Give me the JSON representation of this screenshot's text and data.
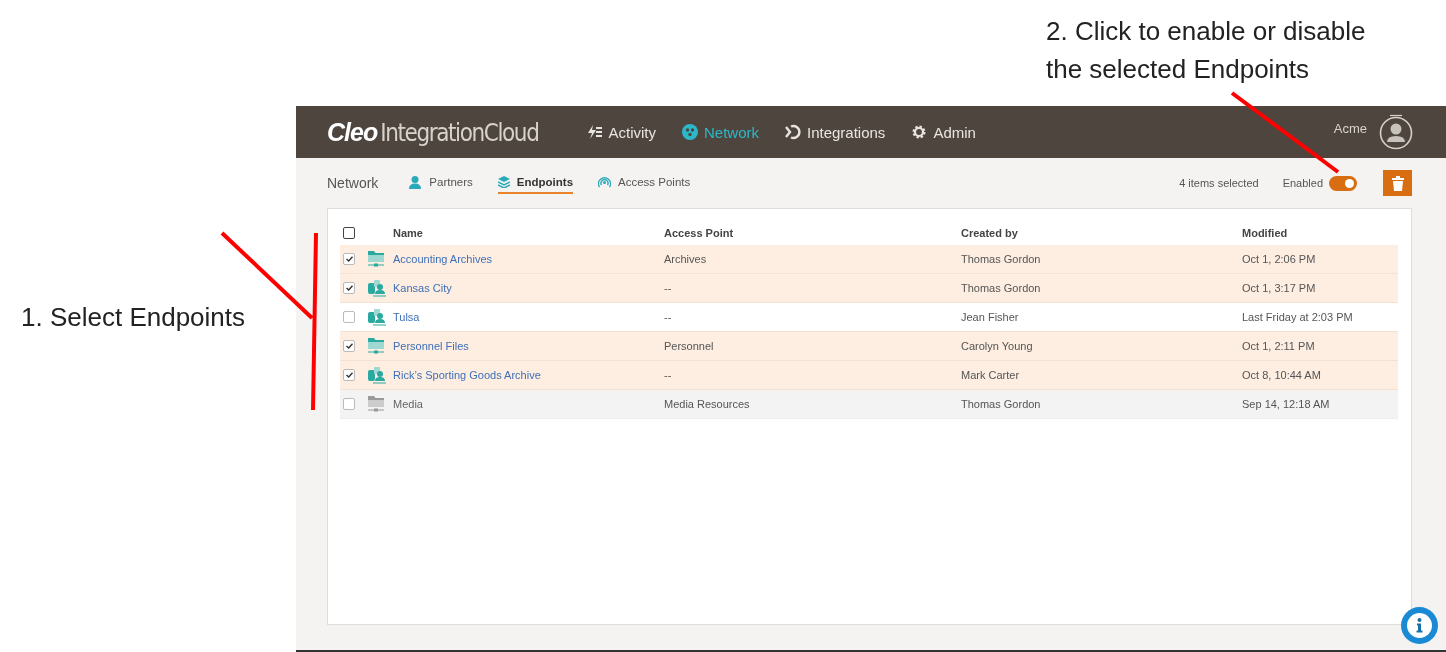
{
  "annotations": [
    {
      "text": "1. Select Endpoints"
    },
    {
      "text": "2. Click to enable or disable the selected Endpoints"
    }
  ],
  "header": {
    "logo_brand": "Cleo",
    "logo_product": "IntegrationCloud",
    "nav": [
      {
        "label": "Activity",
        "kind": "activity",
        "selected": false
      },
      {
        "label": "Network",
        "kind": "network",
        "selected": true
      },
      {
        "label": "Integrations",
        "kind": "integrations",
        "selected": false
      },
      {
        "label": "Admin",
        "kind": "admin",
        "selected": false
      }
    ],
    "user": "Acme"
  },
  "subbar": {
    "section": "Network",
    "tabs": [
      {
        "label": "Partners",
        "kind": "partners",
        "selected": false
      },
      {
        "label": "Endpoints",
        "kind": "endpoints",
        "selected": true
      },
      {
        "label": "Access Points",
        "kind": "access",
        "selected": false
      }
    ],
    "selection_count": "4 items selected",
    "toggle": {
      "label": "Enabled",
      "on": true
    }
  },
  "table": {
    "select_all": false,
    "columns": [
      "Name",
      "Access Point",
      "Created by",
      "Modified"
    ],
    "rows": [
      {
        "kind": "folder",
        "checked": true,
        "enabled": true,
        "name": "Accounting Archives",
        "access_point": "Archives",
        "created_by": "Thomas Gordon",
        "modified": "Oct 1, 2:06 PM"
      },
      {
        "kind": "partner",
        "checked": true,
        "enabled": true,
        "name": "Kansas City",
        "access_point": "--",
        "created_by": "Thomas Gordon",
        "modified": "Oct 1, 3:17 PM"
      },
      {
        "kind": "partner",
        "checked": false,
        "enabled": true,
        "name": "Tulsa",
        "access_point": "--",
        "created_by": "Jean Fisher",
        "modified": "Last Friday at 2:03 PM"
      },
      {
        "kind": "folder",
        "checked": true,
        "enabled": true,
        "name": "Personnel Files",
        "access_point": "Personnel",
        "created_by": "Carolyn Young",
        "modified": "Oct 1, 2:11 PM"
      },
      {
        "kind": "partner",
        "checked": true,
        "enabled": true,
        "name": "Rick’s Sporting Goods Archive",
        "access_point": "--",
        "created_by": "Mark Carter",
        "modified": "Oct 8, 10:44 AM"
      },
      {
        "kind": "folder",
        "checked": false,
        "enabled": false,
        "name": "Media",
        "access_point": "Media Resources",
        "created_by": "Thomas Gordon",
        "modified": "Sep 14, 12:18 AM"
      }
    ]
  }
}
